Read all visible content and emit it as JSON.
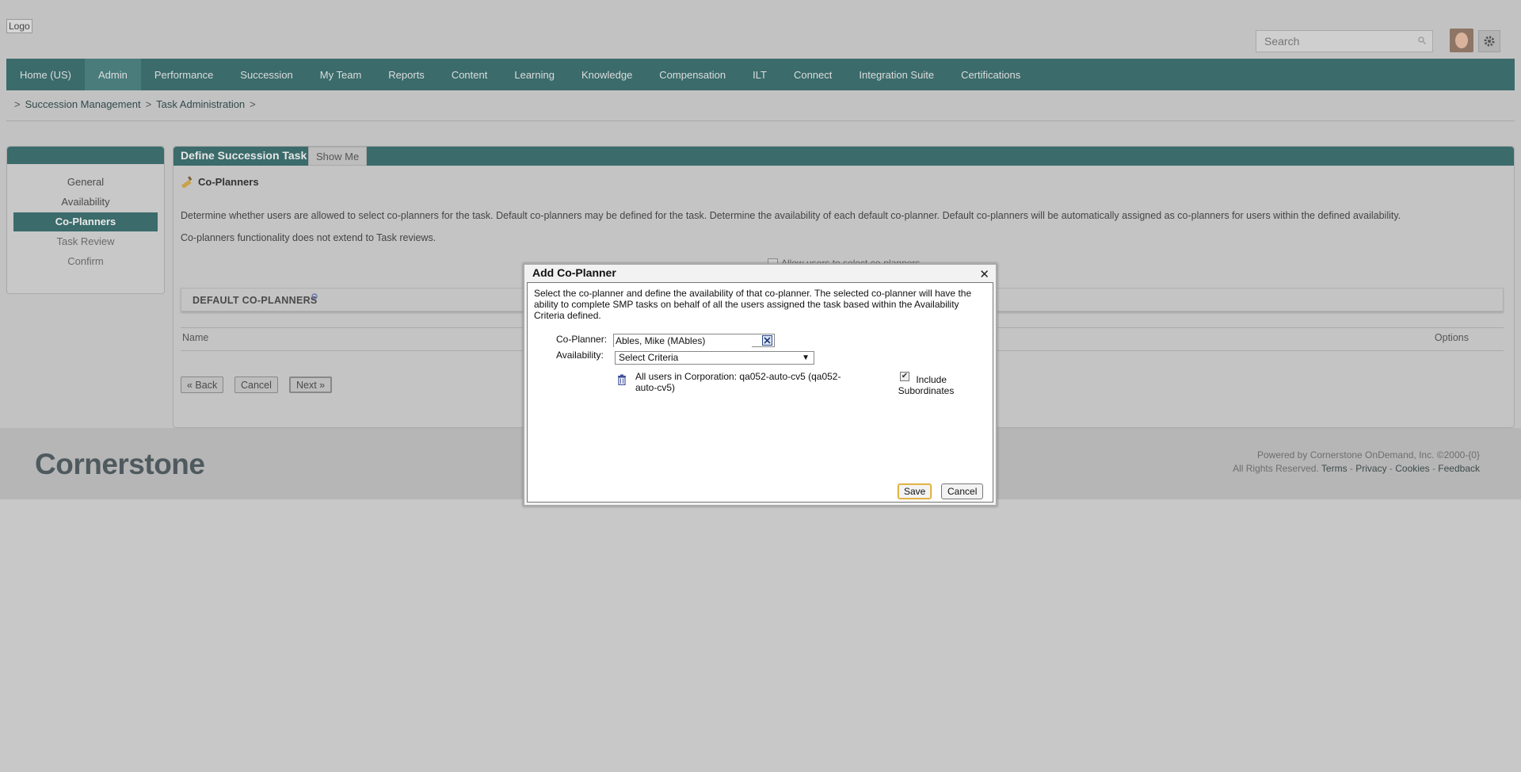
{
  "header": {
    "logo_alt": "Logo",
    "search_placeholder": "Search"
  },
  "nav": {
    "items": [
      "Home (US)",
      "Admin",
      "Performance",
      "Succession",
      "My Team",
      "Reports",
      "Content",
      "Learning",
      "Knowledge",
      "Compensation",
      "ILT",
      "Connect",
      "Integration Suite",
      "Certifications"
    ],
    "active": "Admin"
  },
  "breadcrumb": {
    "items": [
      "Succession Management",
      "Task Administration"
    ]
  },
  "sidebar": {
    "items": [
      "General",
      "Availability",
      "Co-Planners",
      "Task Review",
      "Confirm"
    ],
    "active": "Co-Planners"
  },
  "main": {
    "title": "Define Succession Task",
    "show_me": "Show Me",
    "section_title": "Co-Planners",
    "description": "Determine whether users are allowed to select co-planners for the task. Default co-planners may be defined for the task. Determine the availability of each default co-planner. Default co-planners will be automatically assigned as co-planners for users within the defined availability.",
    "note": "Co-planners functionality does not extend to Task reviews.",
    "allow_label": "Allow users to select co-planners",
    "default_header": "DEFAULT CO-PLANNERS",
    "col_name": "Name",
    "col_options": "Options",
    "back_label": "« Back",
    "cancel_label": "Cancel",
    "next_label": "Next »"
  },
  "footer": {
    "brand": "Cornerstone",
    "powered": "Powered by Cornerstone OnDemand, Inc. ©2000-{0}",
    "rights": "All Rights Reserved.",
    "terms": "Terms",
    "privacy": "Privacy",
    "cookies": "Cookies",
    "feedback": "Feedback"
  },
  "dialog": {
    "title": "Add Co-Planner",
    "close": "✕",
    "intro": "Select the co-planner and define the availability of that co-planner. The selected co-planner will have the ability to complete SMP tasks on behalf of all the users assigned the task based within the Availability Criteria defined.",
    "co_planner_label": "Co-Planner:",
    "co_planner_value": "Ables, Mike (MAbles)",
    "availability_label": "Availability:",
    "availability_selected": "Select Criteria",
    "criteria_text": "All users in Corporation: qa052-auto-cv5 (qa052-auto-cv5)",
    "include_subordinates_label": "Include Subordinates",
    "include_subordinates_checked": true,
    "save_label": "Save",
    "cancel_label": "Cancel"
  },
  "colors": {
    "nav_bg": "#3b6b6b",
    "overlay": "#c8c8c8",
    "dialog_bg": "#f2f2f2"
  }
}
